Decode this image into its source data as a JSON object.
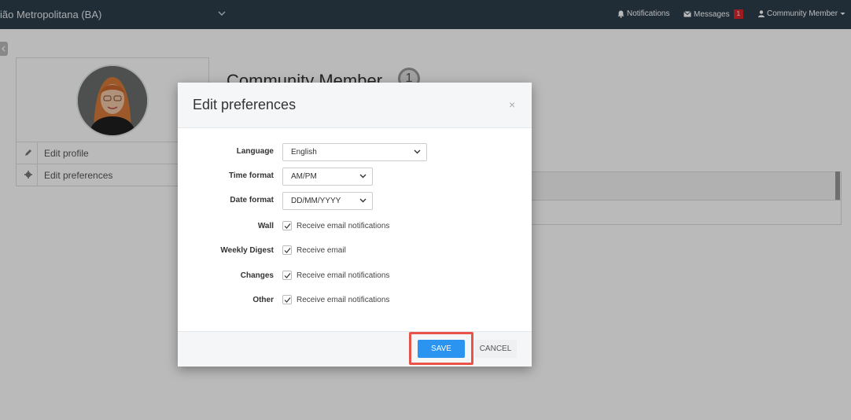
{
  "topbar": {
    "region": "ião Metropolitana (BA)",
    "notifications_label": "Notifications",
    "messages_label": "Messages",
    "messages_count": "1",
    "user_menu_label": "Community Member"
  },
  "profile": {
    "name": "Community Member",
    "level": "1",
    "menu": [
      {
        "label": "Edit profile",
        "icon": "pencil-icon"
      },
      {
        "label": "Edit preferences",
        "icon": "gear-icon"
      }
    ]
  },
  "modal": {
    "title": "Edit preferences",
    "close": "×",
    "fields": {
      "language": {
        "label": "Language",
        "value": "English"
      },
      "time_format": {
        "label": "Time format",
        "value": "AM/PM"
      },
      "date_format": {
        "label": "Date format",
        "value": "DD/MM/YYYY"
      },
      "wall": {
        "label": "Wall",
        "option": "Receive email notifications",
        "checked": true
      },
      "weekly_digest": {
        "label": "Weekly Digest",
        "option": "Receive email",
        "checked": true
      },
      "changes": {
        "label": "Changes",
        "option": "Receive email notifications",
        "checked": true
      },
      "other": {
        "label": "Other",
        "option": "Receive email notifications",
        "checked": true
      }
    },
    "save_label": "SAVE",
    "cancel_label": "CANCEL"
  },
  "colors": {
    "topbar": "#2c3e4c",
    "primary": "#2a94f0",
    "badge": "#d9262d",
    "highlight": "#e8534a"
  }
}
